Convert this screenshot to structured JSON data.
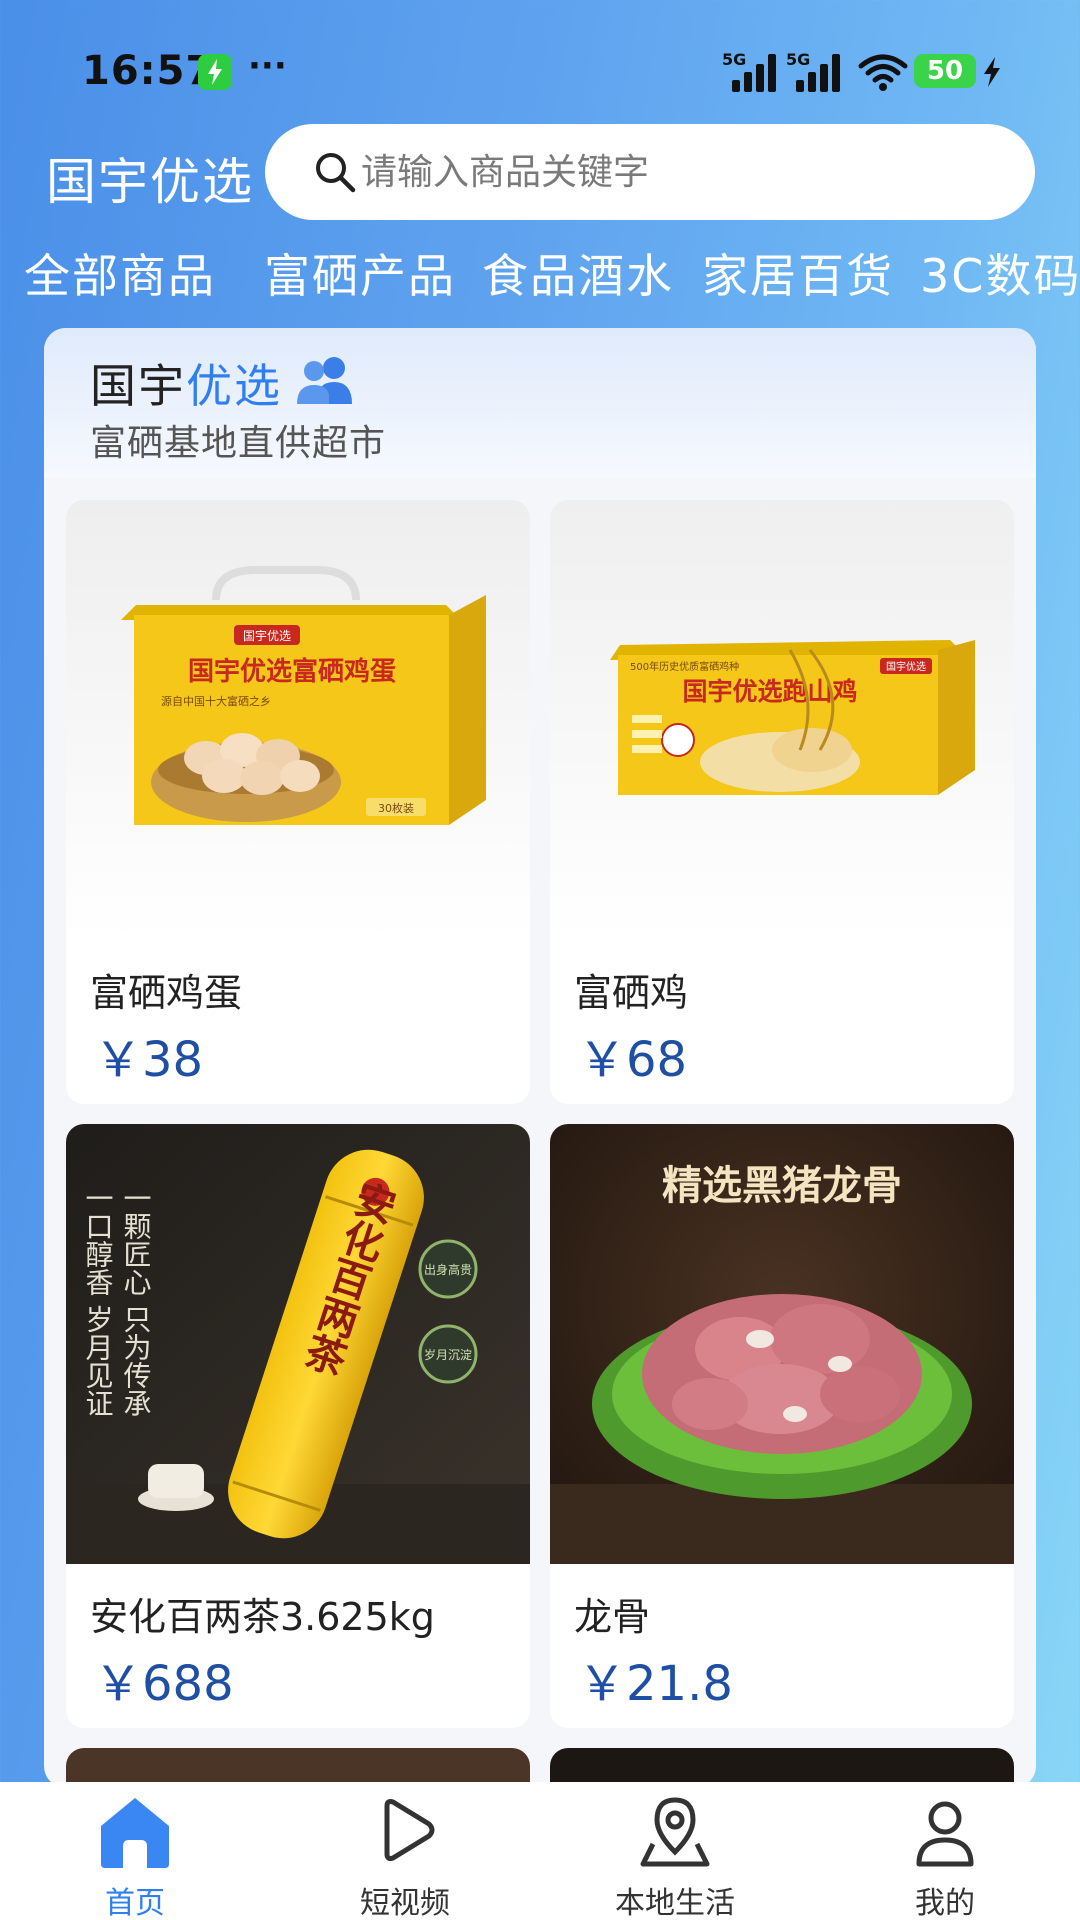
{
  "status_bar": {
    "time": "16:57",
    "more": "···",
    "signal_1_label": "5G",
    "signal_2_label": "5G",
    "battery": "50"
  },
  "header": {
    "brand": "国宇优选",
    "search_placeholder": "请输入商品关键字"
  },
  "tabs": [
    {
      "label": "全部商品",
      "active": true
    },
    {
      "label": "富硒产品"
    },
    {
      "label": "食品酒水"
    },
    {
      "label": "家居百货"
    },
    {
      "label": "3C数码"
    }
  ],
  "banner": {
    "title_main": "国宇",
    "title_accent": "优选",
    "subtitle": "富硒基地直供超市"
  },
  "products": [
    {
      "name": "富硒鸡蛋",
      "price": "￥38",
      "img_title": "国宇优选富硒鸡蛋",
      "img_tag": "国宇优选",
      "img_sub": "源自中国十大富硒之乡",
      "img_count": "30枚装"
    },
    {
      "name": "富硒鸡",
      "price": "￥68",
      "img_title": "国宇优选跑山鸡",
      "img_tag": "国宇优选",
      "img_sub": "500年历史优质富硒鸡种"
    },
    {
      "name": "安化百两茶3.625kg",
      "price": "￥688",
      "img_title": "安化百两茶",
      "img_left_1": "一颗匠心 只为传承",
      "img_left_2": "一口醇香 岁月见证",
      "img_seal_1": "出身高贵",
      "img_seal_2": "岁月沉淀"
    },
    {
      "name": "龙骨",
      "price": "￥21.8",
      "img_title": "精选黑猪龙骨"
    }
  ],
  "bottom_nav": [
    {
      "label": "首页",
      "icon": "home-icon",
      "active": true
    },
    {
      "label": "短视频",
      "icon": "play-icon"
    },
    {
      "label": "本地生活",
      "icon": "location-icon"
    },
    {
      "label": "我的",
      "icon": "user-icon"
    }
  ],
  "colors": {
    "accent": "#2f7ff0",
    "price": "#1e4fa3",
    "battery": "#39d44a"
  }
}
